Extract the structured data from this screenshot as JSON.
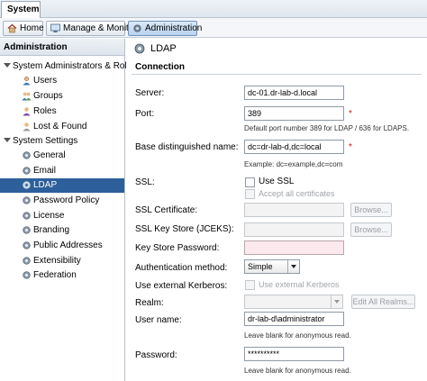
{
  "top_tab": {
    "label": "System"
  },
  "nav": {
    "home_label": "Home",
    "manage_label": "Manage & Monitor",
    "admin_label": "Administration"
  },
  "sidebar": {
    "header": "Administration",
    "groups": [
      {
        "label": "System Administrators & Roles",
        "items": [
          {
            "label": "Users",
            "icon": "user-icon"
          },
          {
            "label": "Groups",
            "icon": "group-icon"
          },
          {
            "label": "Roles",
            "icon": "role-icon"
          },
          {
            "label": "Lost & Found",
            "icon": "lost-found-icon"
          }
        ]
      },
      {
        "label": "System Settings",
        "items": [
          {
            "label": "General",
            "icon": "gear-icon"
          },
          {
            "label": "Email",
            "icon": "gear-icon"
          },
          {
            "label": "LDAP",
            "icon": "gear-icon"
          },
          {
            "label": "Password Policy",
            "icon": "gear-icon"
          },
          {
            "label": "License",
            "icon": "gear-icon"
          },
          {
            "label": "Branding",
            "icon": "gear-icon"
          },
          {
            "label": "Public Addresses",
            "icon": "gear-icon"
          },
          {
            "label": "Extensibility",
            "icon": "gear-icon"
          },
          {
            "label": "Federation",
            "icon": "gear-icon"
          }
        ]
      }
    ],
    "selected": "LDAP"
  },
  "main": {
    "title": "LDAP",
    "section": "Connection",
    "fields": {
      "server": {
        "label": "Server:",
        "value": "dc-01.dr-lab-d.local"
      },
      "port": {
        "label": "Port:",
        "value": "389",
        "hint": "Default port number 389 for LDAP / 636 for LDAPS."
      },
      "base_dn": {
        "label": "Base distinguished name:",
        "value": "dc=dr-lab-d,dc=local",
        "hint": "Example: dc=example,dc=com"
      },
      "ssl": {
        "label": "SSL:",
        "use_ssl": "Use SSL",
        "accept_all": "Accept all certificates"
      },
      "ssl_cert": {
        "label": "SSL Certificate:",
        "browse": "Browse..."
      },
      "ssl_keystore": {
        "label": "SSL Key Store (JCEKS):",
        "browse": "Browse..."
      },
      "keystore_password": {
        "label": "Key Store Password:"
      },
      "auth_method": {
        "label": "Authentication method:",
        "value": "Simple"
      },
      "ext_kerberos": {
        "label": "Use external Kerberos:",
        "check_label": "Use external Kerberos"
      },
      "realm": {
        "label": "Realm:",
        "edit_all": "Edit All Realms..."
      },
      "username": {
        "label": "User name:",
        "value": "dr-lab-d\\administrator",
        "hint": "Leave blank for anonymous read."
      },
      "password": {
        "label": "Password:",
        "value": "**********",
        "hint": "Leave blank for anonymous read."
      }
    },
    "required_mark": "*"
  },
  "colors": {
    "selection": "#2d5f9a",
    "required": "#d01515",
    "accent_border": "#6f93bb"
  }
}
